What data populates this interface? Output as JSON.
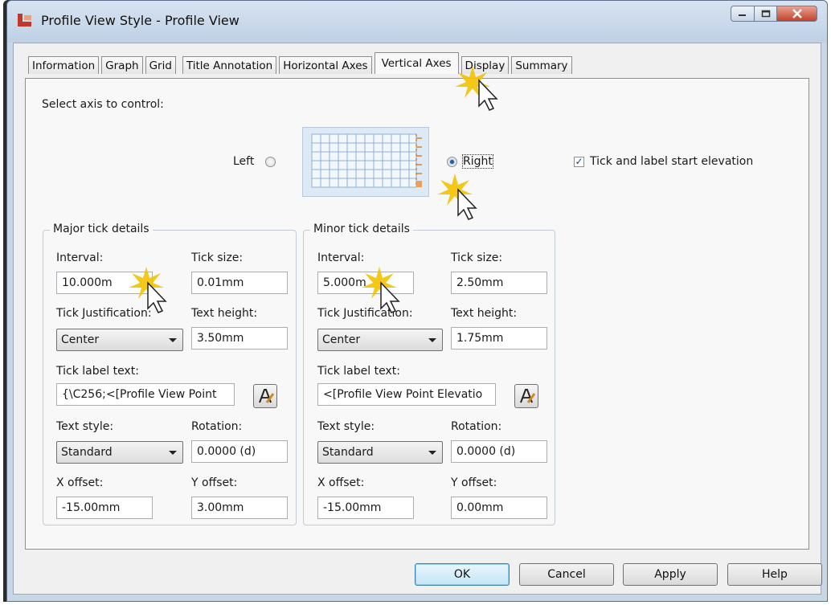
{
  "window": {
    "title": "Profile View Style - Profile View"
  },
  "tabs": [
    {
      "label": "Information",
      "active": false
    },
    {
      "label": "Graph",
      "active": false
    },
    {
      "label": "Grid",
      "active": false
    },
    {
      "label": "Title Annotation",
      "active": false
    },
    {
      "label": "Horizontal Axes",
      "active": false
    },
    {
      "label": "Vertical Axes",
      "active": true
    },
    {
      "label": "Display",
      "active": false
    },
    {
      "label": "Summary",
      "active": false
    }
  ],
  "axis_select": {
    "label": "Select axis to control:",
    "left_label": "Left",
    "right_label": "Right",
    "selected": "Right"
  },
  "tick_start": {
    "label": "Tick and label start elevation",
    "checked": true
  },
  "major": {
    "title": "Major tick details",
    "interval_label": "Interval:",
    "interval": "10.000m",
    "tick_size_label": "Tick size:",
    "tick_size": "0.01mm",
    "justification_label": "Tick Justification:",
    "justification": "Center",
    "text_height_label": "Text height:",
    "text_height": "3.50mm",
    "label_text_label": "Tick label text:",
    "label_text": "{\\C256;<[Profile View Point",
    "text_style_label": "Text style:",
    "text_style": "Standard",
    "rotation_label": "Rotation:",
    "rotation": "0.0000 (d)",
    "x_offset_label": "X offset:",
    "x_offset": "-15.00mm",
    "y_offset_label": "Y offset:",
    "y_offset": "3.00mm"
  },
  "minor": {
    "title": "Minor tick details",
    "interval_label": "Interval:",
    "interval": "5.000m",
    "tick_size_label": "Tick size:",
    "tick_size": "2.50mm",
    "justification_label": "Tick Justification:",
    "justification": "Center",
    "text_height_label": "Text height:",
    "text_height": "1.75mm",
    "label_text_label": "Tick label text:",
    "label_text": "<[Profile View Point Elevatio",
    "text_style_label": "Text style:",
    "text_style": "Standard",
    "rotation_label": "Rotation:",
    "rotation": "0.0000 (d)",
    "x_offset_label": "X offset:",
    "x_offset": "-15.00mm",
    "y_offset_label": "Y offset:",
    "y_offset": "0.00mm"
  },
  "buttons": {
    "ok": "OK",
    "cancel": "Cancel",
    "apply": "Apply",
    "help": "Help"
  },
  "colors": {
    "accent": "#1d5fa8",
    "click_highlight": "#f2c200",
    "close_button": "#c2412a"
  }
}
